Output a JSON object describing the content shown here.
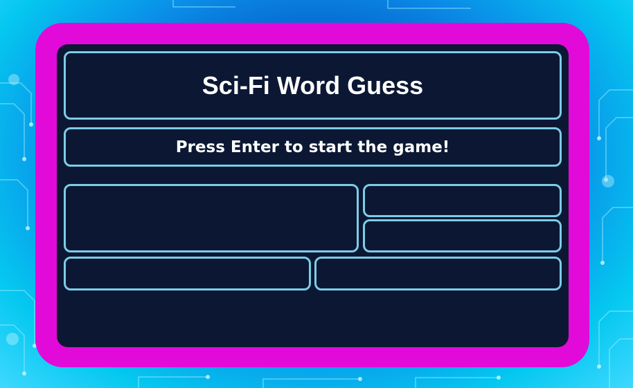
{
  "game": {
    "title": "Sci-Fi Word Guess",
    "message": "Press Enter to start the game!"
  },
  "colors": {
    "frame": "#e10ad9",
    "panel": "#0c1833",
    "box_border": "#7dcde8",
    "text": "#ffffff"
  },
  "slots": {
    "word_display": "",
    "info_top": "",
    "info_bottom": "",
    "left_footer": "",
    "right_footer": ""
  }
}
